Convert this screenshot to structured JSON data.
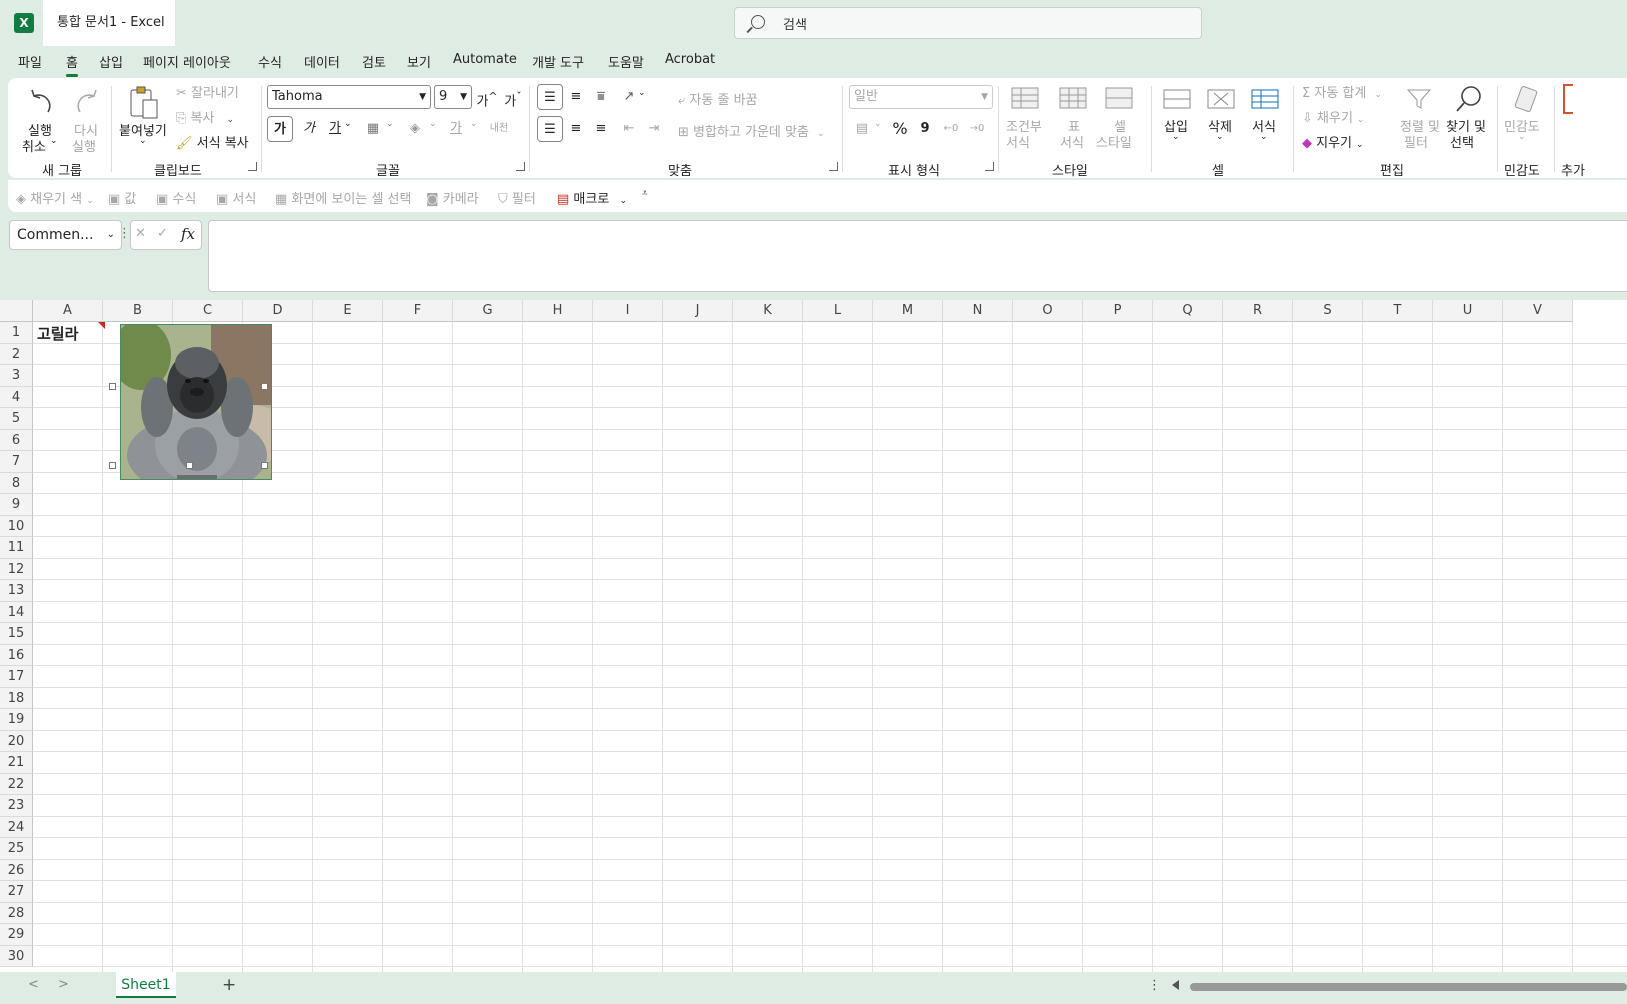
{
  "app": {
    "logo_letter": "X",
    "doc_title": "통합 문서1  -  Excel",
    "search_placeholder": "검색"
  },
  "menu_tabs": [
    "파일",
    "홈",
    "삽입",
    "페이지 레이아웃",
    "수식",
    "데이터",
    "검토",
    "보기",
    "Automate",
    "개발 도구",
    "도움말",
    "Acrobat"
  ],
  "active_tab": "홈",
  "ribbon": {
    "undo": {
      "line1": "실행",
      "line2": "취소"
    },
    "redo": {
      "line1": "다시",
      "line2": "실행"
    },
    "group_new": "새 그룹",
    "paste": "붙여넣기",
    "cut": "잘라내기",
    "copy": "복사",
    "format_painter": "서식 복사",
    "group_clipboard": "클립보드",
    "font_name": "Tahoma",
    "font_size": "9",
    "grow_font": "가",
    "shrink_font": "가",
    "bold": "가",
    "italic": "가",
    "underline": "가",
    "font_color": "가",
    "phonetic": "내천",
    "group_font": "글꼴",
    "wrap_text": "자동 줄 바꿈",
    "merge_center": "병합하고 가운데 맞춤",
    "group_align": "맞춤",
    "number_format": "일반",
    "percent": "%",
    "comma": "9",
    "group_number": "표시 형식",
    "cond_format": {
      "line1": "조건부",
      "line2": "서식"
    },
    "format_table": {
      "line1": "표",
      "line2": "서식"
    },
    "cell_styles": {
      "line1": "셀",
      "line2": "스타일"
    },
    "group_styles": "스타일",
    "insert": "삽입",
    "delete": "삭제",
    "format": "서식",
    "group_cells": "셀",
    "autosum": "자동 합계",
    "fill": "채우기",
    "clear": "지우기",
    "sort_filter": {
      "line1": "정렬 및",
      "line2": "필터"
    },
    "find_select": {
      "line1": "찾기 및",
      "line2": "선택"
    },
    "group_edit": "편집",
    "sensitivity": "민감도",
    "group_sensitivity": "민감도",
    "group_addins": "추가"
  },
  "quick_access": {
    "fill_color": "채우기 색",
    "values": "값",
    "formulas": "수식",
    "formatting": "서식",
    "select_visible": "화면에 보이는 셀 선택",
    "camera": "카메라",
    "filter": "필터",
    "macro": "매크로"
  },
  "formula_bar": {
    "name_box": "Commen...",
    "cancel": "✕",
    "enter": "✓",
    "fx": "fx",
    "formula_value": ""
  },
  "sheet": {
    "columns": [
      "A",
      "B",
      "C",
      "D",
      "E",
      "F",
      "G",
      "H",
      "I",
      "J",
      "K",
      "L",
      "M",
      "N",
      "O",
      "P",
      "Q",
      "R",
      "S",
      "T",
      "U",
      "V"
    ],
    "rows": [
      "1",
      "2",
      "3",
      "4",
      "5",
      "6",
      "7",
      "8",
      "9",
      "10",
      "11",
      "12",
      "13",
      "14",
      "15",
      "16",
      "17",
      "18",
      "19",
      "20",
      "21",
      "22",
      "23",
      "24",
      "25",
      "26",
      "27",
      "28",
      "29",
      "30"
    ],
    "cell_a1": "고릴라",
    "picture_subject": "gorilla"
  },
  "tabs_bar": {
    "sheet_name": "Sheet1",
    "add_sheet": "+",
    "prev": "<",
    "next": ">",
    "more": "⋮"
  },
  "colors": {
    "accent": "#107c41",
    "chrome_bg": "#dfece3",
    "comment_marker": "#c42b1c"
  }
}
